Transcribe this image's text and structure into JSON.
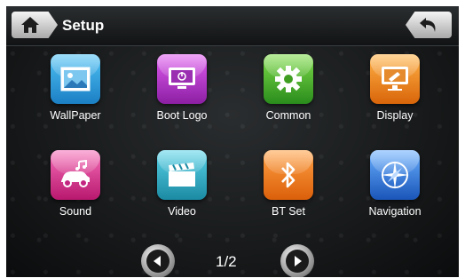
{
  "header": {
    "title": "Setup"
  },
  "apps": [
    {
      "label": "WallPaper",
      "icon": "wallpaper-icon",
      "color": "#2ea0e0"
    },
    {
      "label": "Boot Logo",
      "icon": "boot-logo-icon",
      "color": "#c23bd4"
    },
    {
      "label": "Common",
      "icon": "gear-icon",
      "color": "#3fae2e"
    },
    {
      "label": "Display",
      "icon": "display-icon",
      "color": "#f08a1a"
    },
    {
      "label": "Sound",
      "icon": "sound-icon",
      "color": "#e0358f"
    },
    {
      "label": "Video",
      "icon": "video-icon",
      "color": "#28a7c0"
    },
    {
      "label": "BT Set",
      "icon": "bluetooth-icon",
      "color": "#f07a14"
    },
    {
      "label": "Navigation",
      "icon": "compass-icon",
      "color": "#2f77d8"
    }
  ],
  "pager": {
    "page_text": "1/2"
  }
}
